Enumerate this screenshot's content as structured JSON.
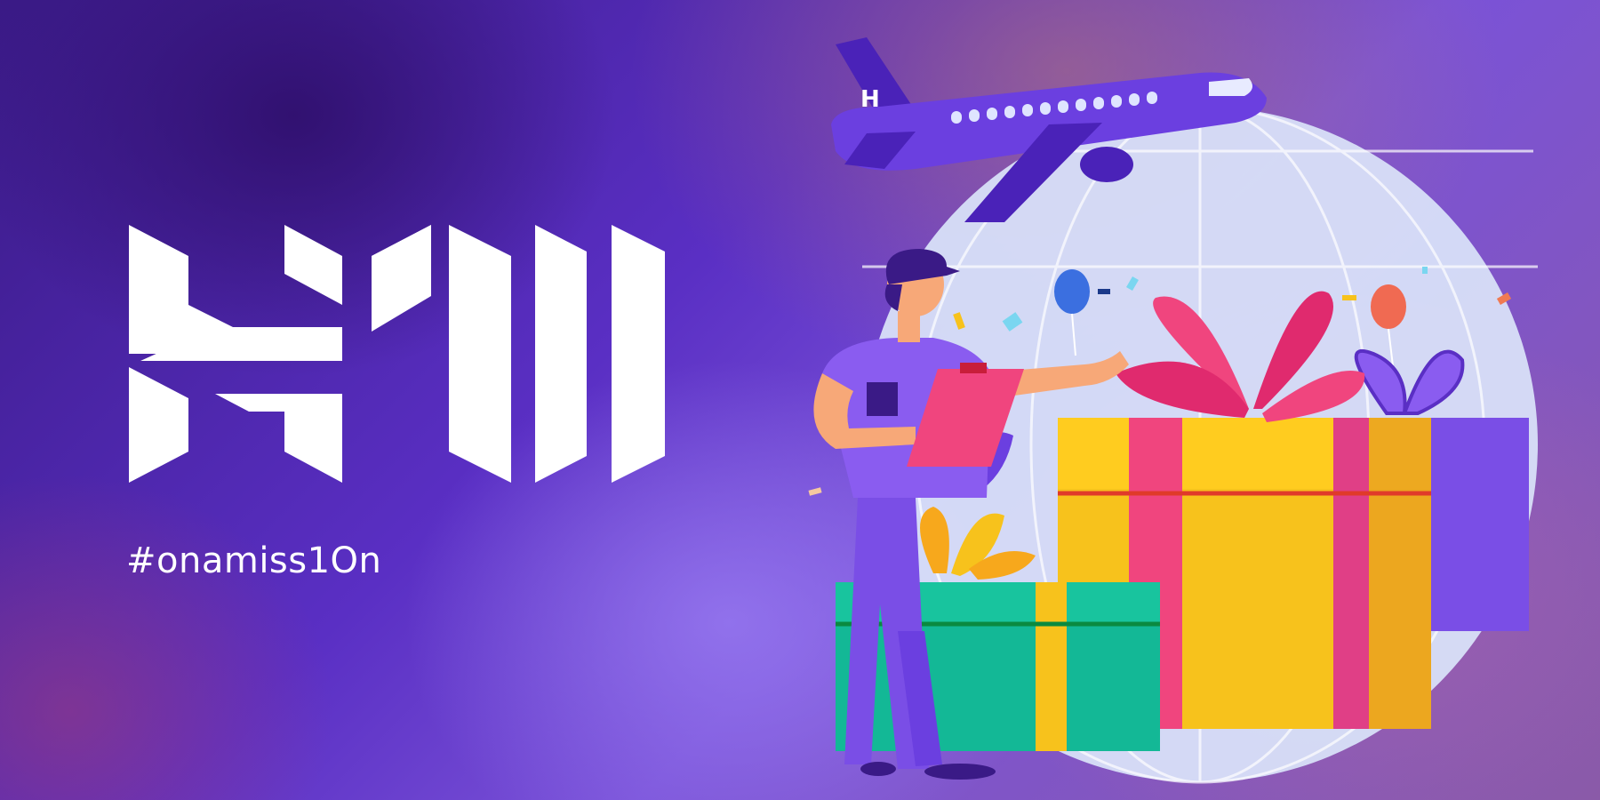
{
  "banner": {
    "logo_text": "H10",
    "hashtag": "#onamiss1On"
  },
  "icons": {
    "logo": "h10-logo",
    "illustration": "courier-with-gift-boxes-and-airplane"
  },
  "colors": {
    "background_dark": "#3a1a86",
    "background_mid": "#6a3be0",
    "accent_purple": "#6b3fe0",
    "gift_yellow": "#f7c21c",
    "gift_pink": "#f0457e",
    "gift_green": "#13b896",
    "text": "#ffffff"
  }
}
